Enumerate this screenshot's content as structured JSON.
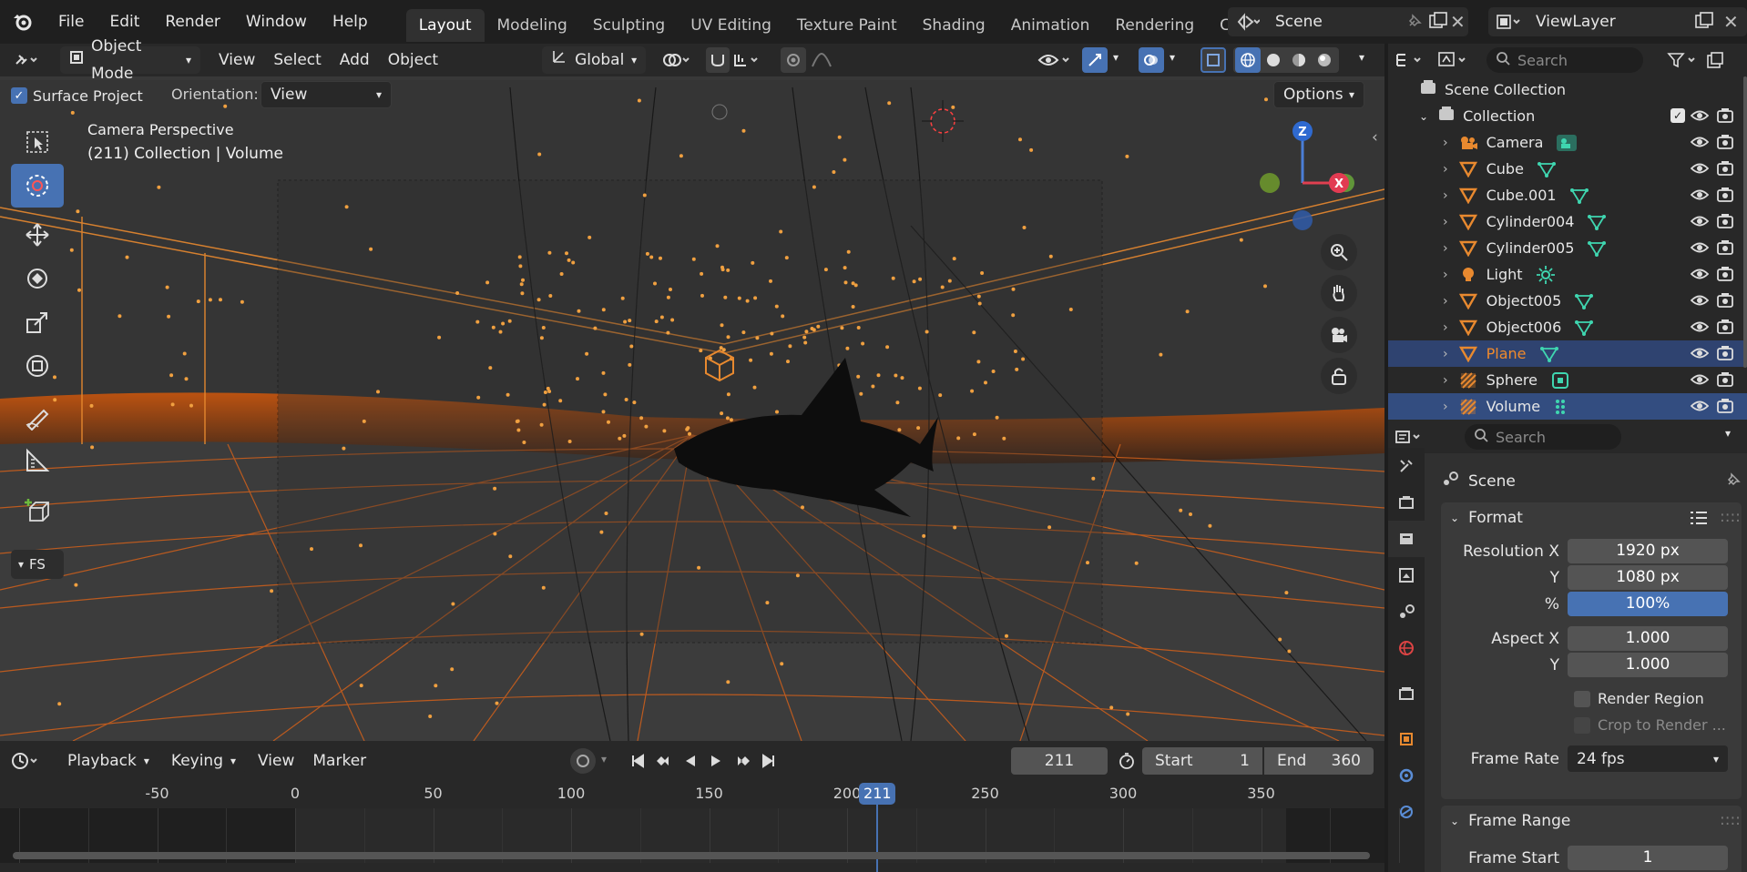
{
  "menus": [
    "File",
    "Edit",
    "Render",
    "Window",
    "Help"
  ],
  "workspaces": [
    "Layout",
    "Modeling",
    "Sculpting",
    "UV Editing",
    "Texture Paint",
    "Shading",
    "Animation",
    "Rendering",
    "Compositing"
  ],
  "active_workspace": "Layout",
  "scene_name": "Scene",
  "view_layer": "ViewLayer",
  "viewport_header": {
    "mode": "Object Mode",
    "menus": [
      "View",
      "Select",
      "Add",
      "Object"
    ],
    "transform_orientation": "Global"
  },
  "tool_settings": {
    "surface_project_label": "Surface Project",
    "surface_project_checked": true,
    "orientation_label": "Orientation:",
    "orientation_value": "View",
    "options_label": "Options"
  },
  "viewport": {
    "title": "Camera Perspective",
    "subtitle": "(211) Collection | Volume",
    "fps_label": "FS",
    "gizmo_axes": {
      "z": "Z",
      "x": "X"
    }
  },
  "outliner": {
    "search_placeholder": "Search",
    "scene_collection": "Scene Collection",
    "collection": "Collection",
    "items": [
      {
        "name": "Camera",
        "icon": "camera-icon",
        "data_icon": "camera-data-icon"
      },
      {
        "name": "Cube",
        "icon": "mesh-object-icon",
        "data_icon": "mesh-data-icon"
      },
      {
        "name": "Cube.001",
        "icon": "mesh-object-icon",
        "data_icon": "mesh-data-icon"
      },
      {
        "name": "Cylinder004",
        "icon": "mesh-object-icon",
        "data_icon": "mesh-data-icon"
      },
      {
        "name": "Cylinder005",
        "icon": "mesh-object-icon",
        "data_icon": "mesh-data-icon"
      },
      {
        "name": "Light",
        "icon": "light-icon",
        "data_icon": "sun-icon"
      },
      {
        "name": "Object005",
        "icon": "mesh-object-icon",
        "data_icon": "mesh-data-icon"
      },
      {
        "name": "Object006",
        "icon": "mesh-object-icon",
        "data_icon": "mesh-data-icon"
      },
      {
        "name": "Plane",
        "icon": "mesh-object-icon",
        "data_icon": "mesh-data-icon"
      },
      {
        "name": "Sphere",
        "icon": "volume-object-icon",
        "data_icon": "volume-data-icon"
      },
      {
        "name": "Volume",
        "icon": "volume-object-icon",
        "data_icon": "pointcloud-data-icon"
      }
    ],
    "selected_item": "Volume",
    "highlighted_item": "Plane"
  },
  "properties": {
    "search_placeholder": "Search",
    "context": "Scene",
    "format_panel": "Format",
    "resolution_x_label": "Resolution X",
    "resolution_x": "1920 px",
    "resolution_y_label": "Y",
    "resolution_y": "1080 px",
    "percent_label": "%",
    "percent": "100%",
    "aspect_x_label": "Aspect X",
    "aspect_x": "1.000",
    "aspect_y_label": "Y",
    "aspect_y": "1.000",
    "render_region": "Render Region",
    "crop_to_render": "Crop to Render ...",
    "frame_rate_label": "Frame Rate",
    "frame_rate": "24 fps",
    "frame_range_panel": "Frame Range",
    "frame_start_label": "Frame Start",
    "frame_start": "1"
  },
  "timeline": {
    "menus": [
      "Playback",
      "Keying",
      "View",
      "Marker"
    ],
    "current_frame": "211",
    "start_label": "Start",
    "start": "1",
    "end_label": "End",
    "end": "360",
    "ruler_labels": [
      "-50",
      "0",
      "50",
      "100",
      "150",
      "200",
      "250",
      "300",
      "350"
    ],
    "ruler_values": [
      -50,
      0,
      50,
      100,
      150,
      200,
      250,
      300,
      350
    ],
    "playhead_label": "211",
    "playhead_frame": 211
  },
  "colors": {
    "accent_blue": "#4772b3",
    "orange": "#e8741f",
    "bg_dark": "#1d1d1d",
    "panel": "#303030"
  }
}
